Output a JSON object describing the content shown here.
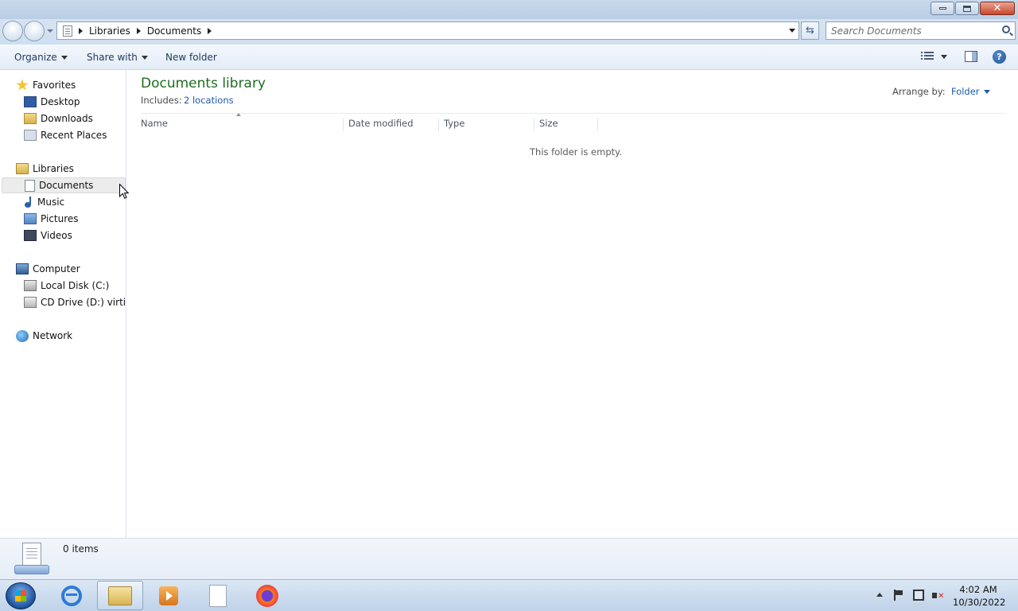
{
  "window": {
    "minimize_label": "",
    "close_label": "✕"
  },
  "address": {
    "breadcrumbs": [
      "Libraries",
      "Documents"
    ],
    "search_placeholder": "Search Documents"
  },
  "toolbar": {
    "organize": "Organize",
    "share_with": "Share with",
    "new_folder": "New folder",
    "help": "?"
  },
  "nav": {
    "favorites": {
      "label": "Favorites",
      "items": [
        "Desktop",
        "Downloads",
        "Recent Places"
      ]
    },
    "libraries": {
      "label": "Libraries",
      "items": [
        "Documents",
        "Music",
        "Pictures",
        "Videos"
      ],
      "selected": "Documents"
    },
    "computer": {
      "label": "Computer",
      "items": [
        "Local Disk (C:)",
        "CD Drive (D:) virtio-w"
      ]
    },
    "network": {
      "label": "Network"
    }
  },
  "library": {
    "title": "Documents library",
    "includes_label": "Includes:",
    "locations_link": "2 locations",
    "arrange_label": "Arrange by:",
    "arrange_value": "Folder"
  },
  "columns": [
    "Name",
    "Date modified",
    "Type",
    "Size"
  ],
  "empty_message": "This folder is empty.",
  "details": {
    "item_count": "0 items"
  },
  "taskbar": {
    "apps": [
      "internet-explorer",
      "windows-explorer",
      "windows-media-player",
      "notepad",
      "firefox"
    ],
    "active": "windows-explorer",
    "clock_time": "4:02 AM",
    "clock_date": "10/30/2022"
  },
  "colors": {
    "library_title": "#1e6e1e",
    "link": "#1e5aa8"
  }
}
